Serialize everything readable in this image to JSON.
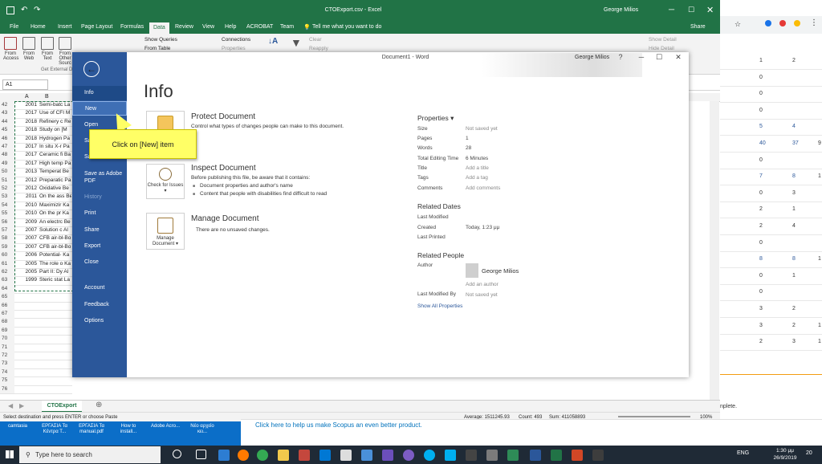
{
  "excel": {
    "title": "CTOExport.csv - Excel",
    "user": "George Milios",
    "share_label": "Share",
    "tabs": [
      "File",
      "Home",
      "Insert",
      "Page Layout",
      "Formulas",
      "Data",
      "Review",
      "View",
      "Help",
      "ACROBAT",
      "Team"
    ],
    "active_tab": "Data",
    "tell_me": "Tell me what you want to do",
    "ribbon": {
      "from_access": "From Access",
      "from_web": "From Web",
      "from_text": "From Text",
      "from_other": "From Other Sourc",
      "show_queries": "Show Queries",
      "from_table": "From Table",
      "connections": "Connections",
      "properties": "Properties",
      "clear": "Clear",
      "reapply": "Reapply",
      "show_detail": "Show Detail",
      "hide_detail": "Hide Detail",
      "group_get_external": "Get External D"
    },
    "name_box": "A1",
    "columns": [
      "A",
      "B"
    ],
    "rows": [
      {
        "n": "42",
        "year": "2001",
        "title": "Semi-batc La"
      },
      {
        "n": "43",
        "year": "2017",
        "title": "Use of CFI M"
      },
      {
        "n": "44",
        "year": "2018",
        "title": "Refinery c Re"
      },
      {
        "n": "45",
        "year": "2018",
        "title": "Study on  [M"
      },
      {
        "n": "46",
        "year": "2018",
        "title": "Hydrogen Pa"
      },
      {
        "n": "47",
        "year": "2017",
        "title": "In situ X-r Pa"
      },
      {
        "n": "48",
        "year": "2017",
        "title": "Ceramic fi Ba"
      },
      {
        "n": "49",
        "year": "2017",
        "title": "High temp Pa"
      },
      {
        "n": "50",
        "year": "2013",
        "title": "Temperat Be"
      },
      {
        "n": "51",
        "year": "2012",
        "title": "Preparatic Pa"
      },
      {
        "n": "52",
        "year": "2012",
        "title": "Oxidative Be"
      },
      {
        "n": "53",
        "year": "2011",
        "title": "On the ass Be"
      },
      {
        "n": "54",
        "year": "2010",
        "title": "Maximizir Ka"
      },
      {
        "n": "55",
        "year": "2010",
        "title": "On the pr Ka"
      },
      {
        "n": "56",
        "year": "2009",
        "title": "An electrc Be"
      },
      {
        "n": "57",
        "year": "2007",
        "title": "Solution c Al"
      },
      {
        "n": "58",
        "year": "2007",
        "title": "CFB air-bl-Bo"
      },
      {
        "n": "59",
        "year": "2007",
        "title": "CFB air-bl-Bo"
      },
      {
        "n": "60",
        "year": "2006",
        "title": "Potential- Ka"
      },
      {
        "n": "61",
        "year": "2005",
        "title": "The role o Ka"
      },
      {
        "n": "62",
        "year": "2005",
        "title": "Part II: Dy Al"
      },
      {
        "n": "63",
        "year": "1999",
        "title": "Steric stat La"
      },
      {
        "n": "64",
        "year": "",
        "title": ""
      },
      {
        "n": "65",
        "year": "",
        "title": ""
      },
      {
        "n": "66",
        "year": "",
        "title": ""
      },
      {
        "n": "67",
        "year": "",
        "title": ""
      },
      {
        "n": "68",
        "year": "",
        "title": ""
      },
      {
        "n": "69",
        "year": "",
        "title": ""
      },
      {
        "n": "70",
        "year": "",
        "title": ""
      },
      {
        "n": "71",
        "year": "",
        "title": ""
      },
      {
        "n": "72",
        "year": "",
        "title": ""
      },
      {
        "n": "73",
        "year": "",
        "title": ""
      },
      {
        "n": "74",
        "year": "",
        "title": ""
      },
      {
        "n": "75",
        "year": "",
        "title": ""
      },
      {
        "n": "76",
        "year": "",
        "title": ""
      }
    ],
    "sheet_tab": "CTOExport",
    "status_left": "Select destination and press ENTER or choose Paste",
    "status_average": "Average: 1511245.93",
    "status_count": "Count: 493",
    "status_sum": "Sum: 411058893",
    "zoom": "100%"
  },
  "word": {
    "doc_title": "Document1 - Word",
    "user": "George Milios",
    "help": "?",
    "side": {
      "info": "Info",
      "new": "New",
      "open": "Open",
      "save": "Save",
      "save_as": "Save As",
      "save_adobe": "Save as Adobe PDF",
      "history": "History",
      "print": "Print",
      "share": "Share",
      "export": "Export",
      "close": "Close",
      "account": "Account",
      "feedback": "Feedback",
      "options": "Options"
    },
    "page_title": "Info",
    "protect": {
      "button": "Protect Document",
      "title": "Protect Document",
      "desc": "Control what types of changes people can make to this document."
    },
    "inspect": {
      "button": "Check for Issues",
      "title": "Inspect Document",
      "desc": "Before publishing this file, be aware that it contains:",
      "b1": "Document properties and author's name",
      "b2": "Content that people with disabilities find difficult to read"
    },
    "manage": {
      "button": "Manage Document",
      "title": "Manage Document",
      "desc": "There are no unsaved changes."
    },
    "properties": {
      "header": "Properties",
      "size_k": "Size",
      "size_v": "Not saved yet",
      "pages_k": "Pages",
      "pages_v": "1",
      "words_k": "Words",
      "words_v": "28",
      "edit_k": "Total Editing Time",
      "edit_v": "6 Minutes",
      "title_k": "Title",
      "title_v": "Add a title",
      "tags_k": "Tags",
      "tags_v": "Add a tag",
      "comments_k": "Comments",
      "comments_v": "Add comments"
    },
    "dates": {
      "header": "Related Dates",
      "modified_k": "Last Modified",
      "created_k": "Created",
      "created_v": "Today, 1:23 μμ",
      "printed_k": "Last Printed"
    },
    "people": {
      "header": "Related People",
      "author_k": "Author",
      "author_v": "George Milios",
      "add_author": "Add an author",
      "modified_by_k": "Last Modified By",
      "modified_by_v": "Not saved yet"
    },
    "show_all": "Show All Properties"
  },
  "callout": "Click on [New] item",
  "browser": {
    "rows": [
      {
        "a": "1",
        "b": "2",
        "c": ""
      },
      {
        "a": "0",
        "b": "",
        "c": ""
      },
      {
        "a": "0",
        "b": "",
        "c": ""
      },
      {
        "a": "0",
        "b": "",
        "c": ""
      },
      {
        "a": "5",
        "b": "4",
        "c": ""
      },
      {
        "a": "40",
        "b": "37",
        "c": "9"
      },
      {
        "a": "0",
        "b": "",
        "c": ""
      },
      {
        "a": "7",
        "b": "8",
        "c": "1"
      },
      {
        "a": "0",
        "b": "3",
        "c": ""
      },
      {
        "a": "2",
        "b": "1",
        "c": ""
      },
      {
        "a": "2",
        "b": "4",
        "c": ""
      },
      {
        "a": "0",
        "b": "",
        "c": ""
      },
      {
        "a": "8",
        "b": "8",
        "c": "1"
      },
      {
        "a": "0",
        "b": "1",
        "c": ""
      },
      {
        "a": "0",
        "b": "",
        "c": ""
      },
      {
        "a": "3",
        "b": "2",
        "c": ""
      },
      {
        "a": "3",
        "b": "2",
        "c": "1"
      },
      {
        "a": "2",
        "b": "3",
        "c": "1"
      }
    ],
    "complete_text": "nplete.",
    "scopus_link": "Click here to help us make Scopus an even better product."
  },
  "desktop_icons": [
    {
      "label": "camtasia"
    },
    {
      "label": "ΕΡΓΑΣΙΑ Τα Κέντρα Τ..."
    },
    {
      "label": "ΕΡΓΑΣΙΑ Τα manual.pdf"
    },
    {
      "label": "How to install..."
    },
    {
      "label": "Adobe Acro..."
    },
    {
      "label": "Νέο αρχείο κει..."
    }
  ],
  "taskbar": {
    "search_placeholder": "Type here to search",
    "lang": "ENG",
    "time": "1:30 μμ",
    "date": "26/9/2019",
    "notif": "20"
  },
  "colors": {
    "excel_green": "#217346",
    "word_blue": "#2b579a",
    "callout_yellow": "#ffff66"
  }
}
